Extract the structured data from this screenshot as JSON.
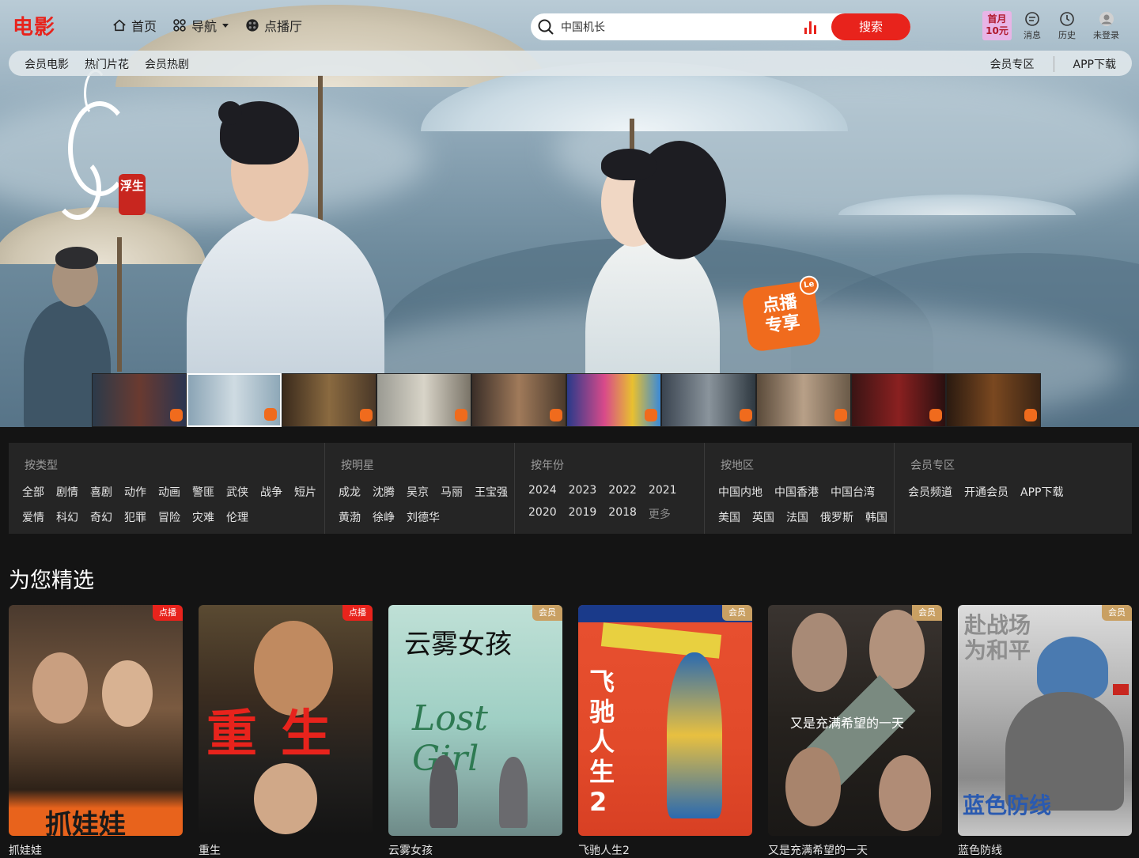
{
  "brand": "电影",
  "nav": {
    "home": "首页",
    "guide": "导航",
    "vod_hall": "点播厅"
  },
  "search": {
    "value": "中国机长",
    "button": "搜索"
  },
  "vip_month": {
    "line1": "首月",
    "line2": "10元"
  },
  "tools": {
    "messages": "消息",
    "history": "历史",
    "login": "未登录"
  },
  "subnav": {
    "left": [
      "会员电影",
      "热门片花",
      "会员热剧"
    ],
    "right": [
      "会员专区",
      "APP下载"
    ]
  },
  "hero": {
    "logo_seal": "浮生",
    "badge_line1": "点播",
    "badge_line2": "专享",
    "badge_le": "Le",
    "thumb_count_active": 2
  },
  "filters": {
    "type": {
      "title": "按类型",
      "row1": [
        "全部",
        "剧情",
        "喜剧",
        "动作",
        "动画",
        "警匪",
        "武侠",
        "战争",
        "短片"
      ],
      "row2": [
        "爱情",
        "科幻",
        "奇幻",
        "犯罪",
        "冒险",
        "灾难",
        "伦理"
      ]
    },
    "star": {
      "title": "按明星",
      "row1": [
        "成龙",
        "沈腾",
        "吴京",
        "马丽",
        "王宝强"
      ],
      "row2": [
        "黄渤",
        "徐峥",
        "刘德华"
      ]
    },
    "year": {
      "title": "按年份",
      "row1": [
        "2024",
        "2023",
        "2022",
        "2021"
      ],
      "row2": [
        "2020",
        "2019",
        "2018"
      ],
      "more": "更多"
    },
    "region": {
      "title": "按地区",
      "row1": [
        "中国内地",
        "中国香港",
        "中国台湾"
      ],
      "row2": [
        "美国",
        "英国",
        "法国",
        "俄罗斯",
        "韩国"
      ]
    },
    "vip": {
      "title": "会员专区",
      "row1": [
        "会员频道",
        "开通会员",
        "APP下载"
      ]
    }
  },
  "recommend": {
    "title": "为您精选",
    "items": [
      {
        "name": "抓娃娃",
        "tag": "点播",
        "poster_text": "抓娃娃"
      },
      {
        "name": "重生",
        "tag": "点播",
        "poster_text": "重生"
      },
      {
        "name": "云雾女孩",
        "tag": "会员",
        "poster_text": "云雾女孩",
        "poster_sub": "Lost Girl"
      },
      {
        "name": "飞驰人生2",
        "tag": "会员",
        "poster_text": "飞驰人生2"
      },
      {
        "name": "又是充满希望的一天",
        "tag": "会员",
        "poster_text": "又是充满希望的一天"
      },
      {
        "name": "蓝色防线",
        "tag": "会员",
        "poster_text": "蓝色防线",
        "poster_top": "赴战场 为和平"
      }
    ]
  },
  "colors": {
    "accent": "#e8231c",
    "vip_gold": "#c9a063",
    "panel": "#252525",
    "bg": "#141414"
  }
}
